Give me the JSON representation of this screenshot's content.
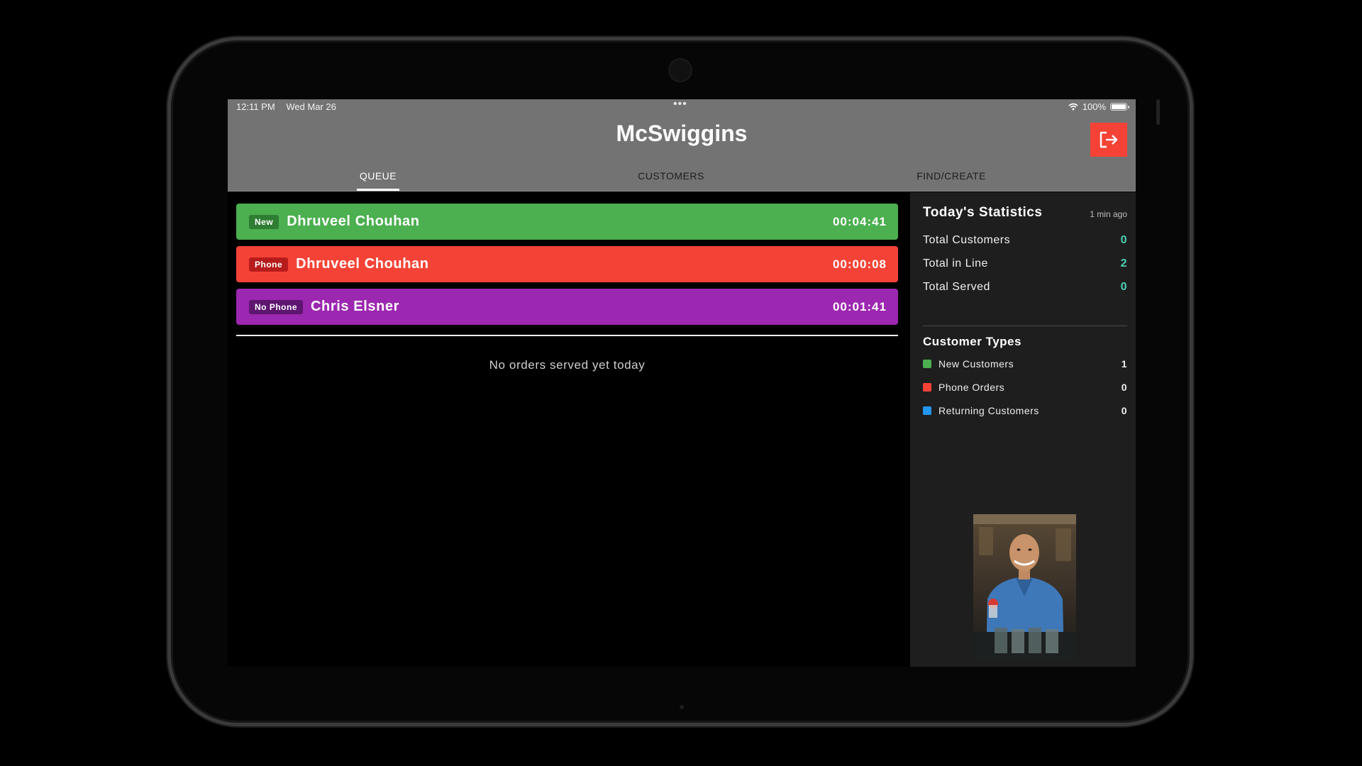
{
  "status_bar": {
    "time": "12:11 PM",
    "date": "Wed Mar 26",
    "dots": "•••",
    "battery": "100%"
  },
  "app": {
    "title": "McSwiggins"
  },
  "tabs": [
    {
      "label": "QUEUE",
      "active": true
    },
    {
      "label": "CUSTOMERS",
      "active": false
    },
    {
      "label": "FIND/CREATE",
      "active": false
    }
  ],
  "queue": [
    {
      "badge": "New",
      "name": "Dhruveel Chouhan",
      "time": "00:04:41",
      "color": "#4caf50",
      "badge_color": "#2e7d32"
    },
    {
      "badge": "Phone",
      "name": "Dhruveel Chouhan",
      "time": "00:00:08",
      "color": "#f44336",
      "badge_color": "#b71c1c"
    },
    {
      "badge": "No Phone",
      "name": "Chris Elsner",
      "time": "00:01:41",
      "color": "#9c27b0",
      "badge_color": "#5e1670"
    }
  ],
  "served": {
    "empty_message": "No orders served yet today"
  },
  "stats": {
    "title": "Today's Statistics",
    "updated": "1 min ago",
    "rows": [
      {
        "label": "Total Customers",
        "value": "0"
      },
      {
        "label": "Total in Line",
        "value": "2"
      },
      {
        "label": "Total Served",
        "value": "0"
      }
    ],
    "types_title": "Customer Types",
    "types": [
      {
        "label": "New Customers",
        "count": "1",
        "color": "#4caf50"
      },
      {
        "label": "Phone Orders",
        "count": "0",
        "color": "#f44336"
      },
      {
        "label": "Returning Customers",
        "count": "0",
        "color": "#2196f3"
      }
    ]
  },
  "colors": {
    "header": "#737373",
    "accent_logout": "#f44336",
    "stat_value": "#4dd0b5"
  }
}
